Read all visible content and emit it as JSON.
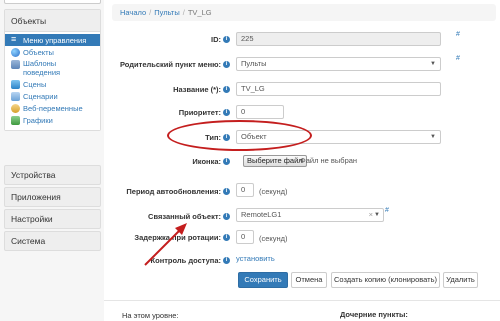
{
  "sidebar": {
    "objects_header": "Объекты",
    "items": [
      {
        "label": "Меню управления",
        "icon": "list-icon",
        "active": true
      },
      {
        "label": "Объекты",
        "icon": "globe-icon",
        "active": false
      },
      {
        "label": "Шаблоны поведения",
        "icon": "template-icon",
        "active": false
      },
      {
        "label": "Сцены",
        "icon": "scene-icon",
        "active": false
      },
      {
        "label": "Сценарии",
        "icon": "script-icon",
        "active": false
      },
      {
        "label": "Веб-переменные",
        "icon": "web-icon",
        "active": false
      },
      {
        "label": "Графики",
        "icon": "chart-icon",
        "active": false
      }
    ],
    "categories": [
      "Устройства",
      "Приложения",
      "Настройки",
      "Система"
    ]
  },
  "breadcrumb": {
    "home": "Начало",
    "section": "Пульты",
    "current": "TV_LG",
    "separator": "/"
  },
  "form": {
    "id_label": "ID:",
    "id_value": "225",
    "parent_label": "Родительский пункт меню:",
    "parent_value": "Пульты",
    "title_label": "Название (*):",
    "title_value": "TV_LG",
    "priority_label": "Приоритет:",
    "priority_value": "0",
    "type_label": "Тип:",
    "type_value": "Объект",
    "icon_label": "Иконка:",
    "file_button": "Выберите файл",
    "file_none": "Файл не выбран",
    "autoupdate_label": "Период автообновления:",
    "autoupdate_value": "0",
    "autoupdate_unit": "(секунд)",
    "linked_label": "Связанный объект:",
    "linked_value": "RemoteLG1",
    "linked_clear": "×",
    "rotation_label": "Задержка при ротации:",
    "rotation_value": "0",
    "rotation_unit": "(секунд)",
    "access_label": "Контроль доступа:",
    "access_link": "установить",
    "hash": "#",
    "info_glyph": "i",
    "arrow_glyph": "▼"
  },
  "buttons": {
    "save": "Сохранить",
    "cancel": "Отмена",
    "clone": "Создать копию (клонировать)",
    "delete": "Удалить"
  },
  "bottom": {
    "level": "На этом уровне:",
    "children": "Дочерние пункты:"
  },
  "colors": {
    "accent": "#337ab7",
    "annotation": "#c41e1e"
  }
}
